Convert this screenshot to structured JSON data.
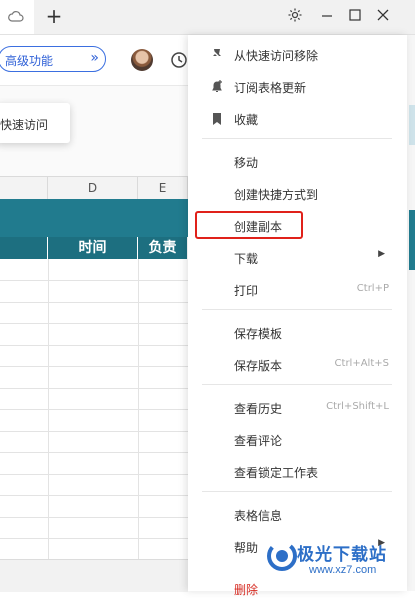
{
  "tabbar": {
    "new_tab": "+"
  },
  "toolbar": {
    "advanced_label": "高级功能",
    "advanced_chevron": "»"
  },
  "popup": {
    "quick_access": "快速访问"
  },
  "sheet": {
    "columns": [
      "D",
      "E"
    ],
    "headers": [
      "时间",
      "负责"
    ]
  },
  "menu": {
    "items": [
      {
        "label": "从快速访问移除",
        "icon": "unpin-icon"
      },
      {
        "label": "订阅表格更新",
        "icon": "bell-plus-icon"
      },
      {
        "label": "收藏",
        "icon": "bookmark-icon"
      },
      {
        "label": "移动"
      },
      {
        "label": "创建快捷方式到"
      },
      {
        "label": "创建副本"
      },
      {
        "label": "下载",
        "submenu": true
      },
      {
        "label": "打印",
        "shortcut": "Ctrl+P"
      },
      {
        "label": "保存模板"
      },
      {
        "label": "保存版本",
        "shortcut": "Ctrl+Alt+S"
      },
      {
        "label": "查看历史",
        "shortcut": "Ctrl+Shift+L"
      },
      {
        "label": "查看评论"
      },
      {
        "label": "查看锁定工作表"
      },
      {
        "label": "表格信息"
      },
      {
        "label": "帮助",
        "submenu": true
      },
      {
        "label": "删除"
      }
    ],
    "highlight_color": "#e0211a"
  },
  "watermark": {
    "name": "极光下载站",
    "url": "www.xz7.com"
  },
  "colors": {
    "teal": "#217b8e",
    "link_blue": "#2d5fd7",
    "danger": "#d62b22"
  }
}
